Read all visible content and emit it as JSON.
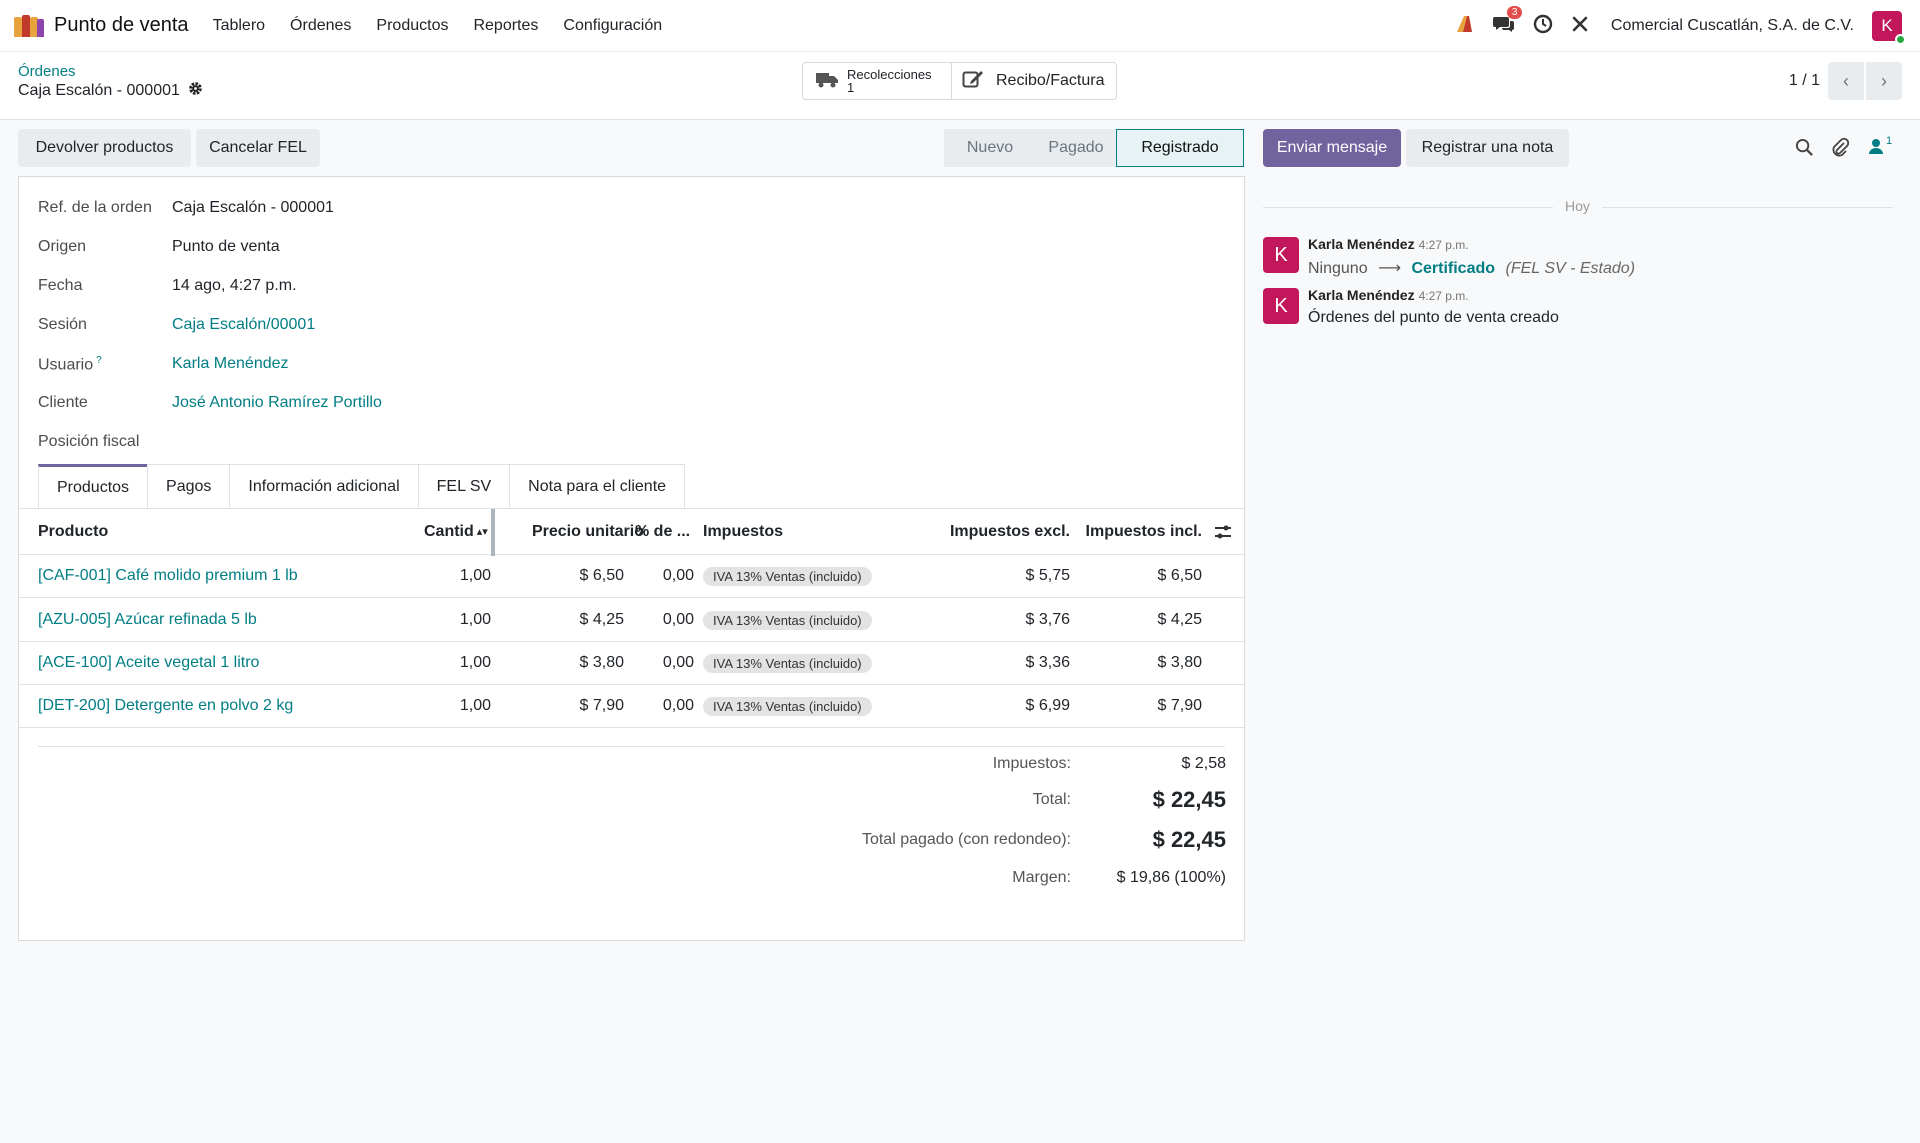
{
  "navbar": {
    "app_title": "Punto de venta",
    "menu": [
      "Tablero",
      "Órdenes",
      "Productos",
      "Reportes",
      "Configuración"
    ],
    "messages_badge": "3",
    "company": "Comercial Cuscatlán, S.A. de C.V.",
    "avatar_letter": "K"
  },
  "control": {
    "breadcrumb": "Órdenes",
    "record_name": "Caja Escalón - 000001",
    "smart_buttons": {
      "pickings_label": "Recolecciones",
      "pickings_count": "1",
      "receipt_label": "Recibo/Factura"
    },
    "pager": "1 / 1"
  },
  "actions": {
    "refund": "Devolver productos",
    "cancel_fel": "Cancelar FEL"
  },
  "statusbar": [
    "Nuevo",
    "Pagado",
    "Registrado"
  ],
  "fields": [
    {
      "label": "Ref. de la orden",
      "value": "Caja Escalón - 000001",
      "link": false
    },
    {
      "label": "Origen",
      "value": "Punto de venta",
      "link": false
    },
    {
      "label": "Fecha",
      "value": "14 ago, 4:27 p.m.",
      "link": false
    },
    {
      "label": "Sesión",
      "value": "Caja Escalón/00001",
      "link": true
    },
    {
      "label": "Usuario",
      "value": "Karla Menéndez",
      "link": true
    },
    {
      "label": "Cliente",
      "value": "José Antonio Ramírez Portillo",
      "link": true
    },
    {
      "label": "Posición fiscal",
      "value": "",
      "link": false
    }
  ],
  "tabs": [
    "Productos",
    "Pagos",
    "Información adicional",
    "FEL SV",
    "Nota para el cliente"
  ],
  "table": {
    "headers": {
      "product": "Producto",
      "qty": "Cantid",
      "price": "Precio unitario",
      "discount": "% de ...",
      "taxes": "Impuestos",
      "excl": "Impuestos excl.",
      "incl": "Impuestos incl."
    },
    "rows": [
      {
        "product": "[CAF-001] Café molido premium 1 lb",
        "qty": "1,00",
        "price": "$ 6,50",
        "discount": "0,00",
        "tax": "IVA 13% Ventas (incluido)",
        "excl": "$ 5,75",
        "incl": "$ 6,50"
      },
      {
        "product": "[AZU-005] Azúcar refinada 5 lb",
        "qty": "1,00",
        "price": "$ 4,25",
        "discount": "0,00",
        "tax": "IVA 13% Ventas (incluido)",
        "excl": "$ 3,76",
        "incl": "$ 4,25"
      },
      {
        "product": "[ACE-100] Aceite vegetal 1 litro",
        "qty": "1,00",
        "price": "$ 3,80",
        "discount": "0,00",
        "tax": "IVA 13% Ventas (incluido)",
        "excl": "$ 3,36",
        "incl": "$ 3,80"
      },
      {
        "product": "[DET-200] Detergente en polvo 2 kg",
        "qty": "1,00",
        "price": "$ 7,90",
        "discount": "0,00",
        "tax": "IVA 13% Ventas (incluido)",
        "excl": "$ 6,99",
        "incl": "$ 7,90"
      }
    ]
  },
  "totals": {
    "taxes_label": "Impuestos:",
    "taxes": "$ 2,58",
    "total_label": "Total:",
    "total": "$ 22,45",
    "paid_label": "Total pagado (con redondeo):",
    "paid": "$ 22,45",
    "margin_label": "Margen:",
    "margin": "$ 19,86 (100%)"
  },
  "chatter": {
    "send_message": "Enviar mensaje",
    "log_note": "Registrar una nota",
    "followers_count": "1",
    "date_separator": "Hoy",
    "messages": [
      {
        "author": "Karla Menéndez",
        "time": "4:27 p.m.",
        "from": "Ninguno",
        "to": "Certificado",
        "field": "(FEL SV - Estado)"
      },
      {
        "author": "Karla Menéndez",
        "time": "4:27 p.m.",
        "body": "Órdenes del punto de venta creado"
      }
    ]
  }
}
